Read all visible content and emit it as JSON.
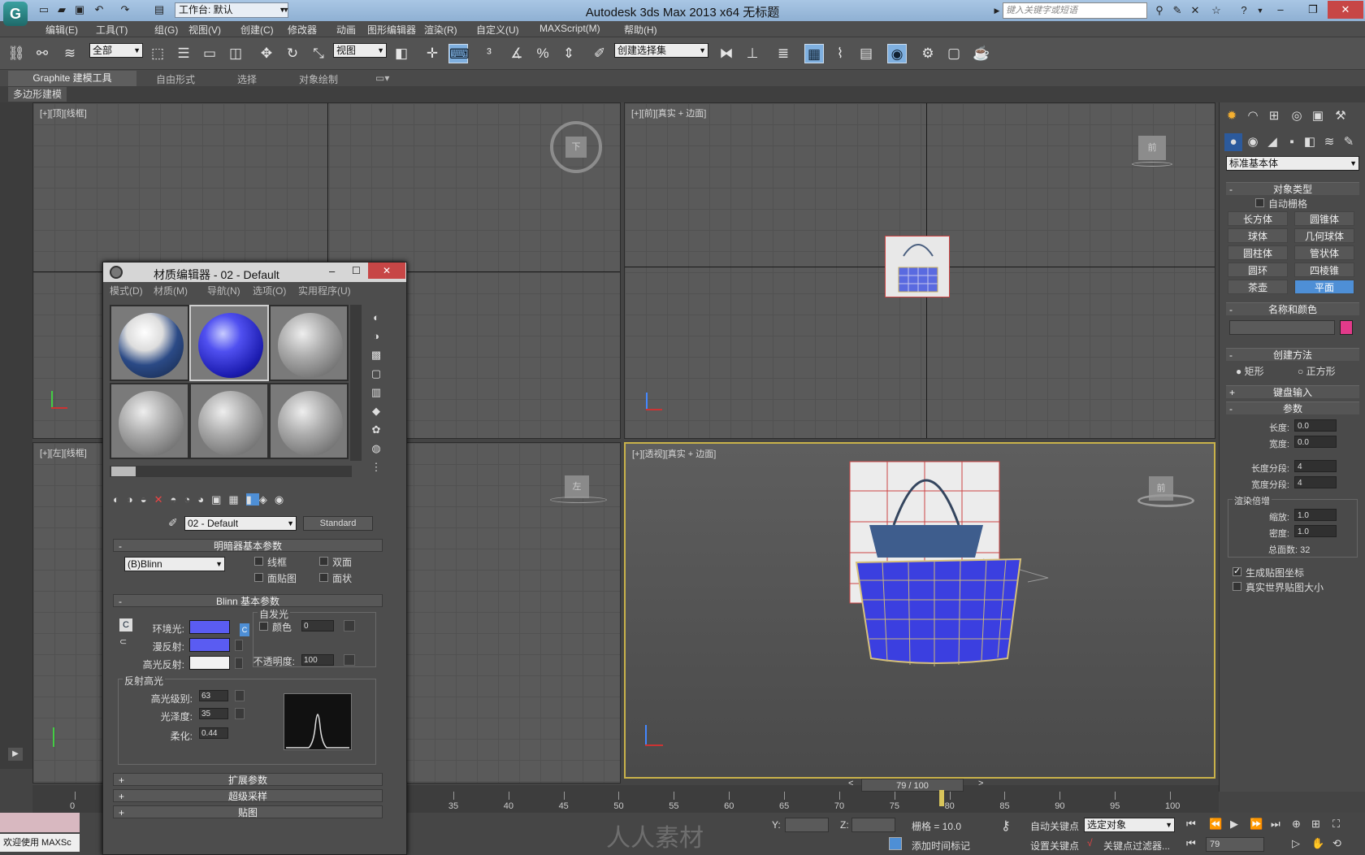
{
  "titlebar": {
    "app_title": "Autodesk 3ds Max  2013 x64      无标题",
    "workspace": "工作台: 默认",
    "search_placeholder": "键入关键字或短语"
  },
  "menubar": [
    "编辑(E)",
    "工具(T)",
    "组(G)",
    "视图(V)",
    "创建(C)",
    "修改器",
    "动画",
    "图形编辑器",
    "渲染(R)",
    "自定义(U)",
    "MAXScript(M)",
    "帮助(H)"
  ],
  "toolbar": {
    "selection_filter": "全部",
    "ref_coord": "视图",
    "named_selection": "创建选择集"
  },
  "ribbon": {
    "tabs": [
      "Graphite 建模工具",
      "自由形式",
      "选择",
      "对象绘制"
    ],
    "subtab": "多边形建模"
  },
  "viewports": {
    "top": "[+][顶][线框]",
    "front": "[+][前][真实 + 边面]",
    "left": "[+][左][线框]",
    "persp": "[+][透视][真实 + 边面]"
  },
  "viewcube": {
    "top": "下",
    "front": "前",
    "left": "左",
    "persp": "前"
  },
  "material_editor": {
    "title": "材质编辑器 - 02 - Default",
    "menus": [
      "模式(D)",
      "材质(M)",
      "导航(N)",
      "选项(O)",
      "实用程序(U)"
    ],
    "material_name": "02 - Default",
    "material_type": "Standard",
    "shader_rollout": "明暗器基本参数",
    "shader": "(B)Blinn",
    "shader_opts": [
      "线框",
      "双面",
      "面贴图",
      "面状"
    ],
    "blinn_rollout": "Blinn 基本参数",
    "self_illum": "自发光",
    "ambient": "环境光:",
    "diffuse": "漫反射:",
    "specular": "高光反射:",
    "color_label": "颜色",
    "self_illum_val": "0",
    "opacity_label": "不透明度:",
    "opacity": "100",
    "spec_group": "反射高光",
    "spec_level_label": "高光级别:",
    "spec_level": "63",
    "gloss_label": "光泽度:",
    "gloss": "35",
    "soften_label": "柔化:",
    "soften": "0.44",
    "extra_rollouts": [
      "扩展参数",
      "超级采样",
      "贴图"
    ],
    "colors": {
      "ambient": "#5a5cf2",
      "diffuse": "#5a5cf2",
      "specular": "#f2f2f2"
    }
  },
  "command_panel": {
    "category": "标准基本体",
    "object_type": "对象类型",
    "autogrid": "自动栅格",
    "buttons": [
      "长方体",
      "圆锥体",
      "球体",
      "几何球体",
      "圆柱体",
      "管状体",
      "圆环",
      "四棱锥",
      "茶壶",
      "平面"
    ],
    "name_color": "名称和颜色",
    "create_method": "创建方法",
    "rect": "矩形",
    "square": "正方形",
    "keyboard": "键盘输入",
    "params": "参数",
    "length_label": "长度:",
    "length": "0.0",
    "width_label": "宽度:",
    "width": "0.0",
    "lsegs_label": "长度分段:",
    "lsegs": "4",
    "wsegs_label": "宽度分段:",
    "wsegs": "4",
    "render_mult": "渲染倍增",
    "scale_label": "缩放:",
    "scale": "1.0",
    "density_label": "密度:",
    "density": "1.0",
    "total_faces": "总面数: 32",
    "gen_map": "生成贴图坐标",
    "real_world": "真实世界贴图大小",
    "object_color": "#e23a8a"
  },
  "timeline": {
    "frame": "79 / 100",
    "ticks": [
      "0",
      "35",
      "40",
      "45",
      "50",
      "55",
      "60",
      "65",
      "70",
      "75",
      "80",
      "85",
      "90",
      "95",
      "100"
    ]
  },
  "statusbar": {
    "welcome": "欢迎使用 MAXSc",
    "grid": "栅格 = 10.0",
    "autokey": "自动关键点",
    "setkey": "设置关键点",
    "selected": "选定对象",
    "keyfilter": "关键点过滤器...",
    "add_time_tag": "添加时间标记",
    "current_frame": "79",
    "y_label": "Y:",
    "z_label": "Z:",
    "watermark": "人人素材"
  }
}
